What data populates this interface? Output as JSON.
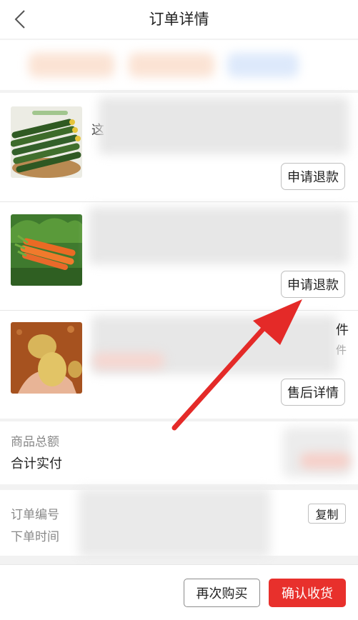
{
  "header": {
    "title": "订单详情"
  },
  "products": [
    {
      "name_partial": "这",
      "action_label": "申请退款"
    },
    {
      "action_label": "申请退款"
    },
    {
      "qty_text": "件",
      "qty_text2": "件",
      "action_label": "售后详情"
    }
  ],
  "totals": {
    "subtotal_label": "商品总额",
    "paid_label": "合计实付"
  },
  "order_info": {
    "number_label": "订单编号",
    "time_label": "下单时间",
    "copy_label": "复制"
  },
  "bottom": {
    "rebuy_label": "再次购买",
    "confirm_label": "确认收货"
  },
  "colors": {
    "accent": "#e8302c",
    "arrow": "#e42a28"
  },
  "icons": [
    "back-arrow-icon"
  ]
}
